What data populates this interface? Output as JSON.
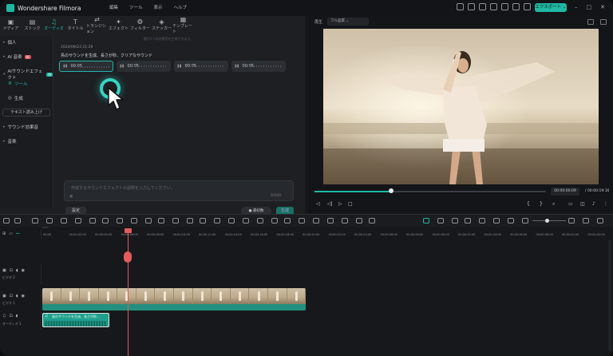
{
  "app": {
    "title": "Wondershare Filmora",
    "export_label": "エクスポート ⌄"
  },
  "menu": [
    "編集",
    "ツール",
    "表示",
    "ヘルプ"
  ],
  "tabs": [
    {
      "label": "メディア",
      "icon": "media-icon"
    },
    {
      "label": "ストック",
      "icon": "stock-icon"
    },
    {
      "label": "オーディオ",
      "icon": "music-note-icon"
    },
    {
      "label": "タイトル",
      "icon": "title-icon"
    },
    {
      "label": "トランジション",
      "icon": "transition-icon"
    },
    {
      "label": "エフェクト",
      "icon": "effect-icon"
    },
    {
      "label": "フィルター",
      "icon": "filter-icon"
    },
    {
      "label": "ステッカー",
      "icon": "sticker-icon"
    },
    {
      "label": "テンプレート",
      "icon": "template-icon"
    }
  ],
  "sidebar": {
    "items": [
      {
        "label": "個人"
      },
      {
        "label": "AI 音楽",
        "badge": "AI"
      },
      {
        "label": "AIサウンドエフェクト",
        "badge": "AI"
      },
      {
        "label": "ツール"
      },
      {
        "label": "生成"
      },
      {
        "label": "サウンド効果音"
      },
      {
        "label": "音楽"
      }
    ],
    "tts_button": "テキスト読み上げ"
  },
  "content": {
    "hint": "最大5つの効果音を生成できます。",
    "timestamp": "2024/09/23 21:29",
    "prompt": "鳥のサウンドを生成、長さが秒、クリアなサウンド",
    "results": [
      "00:05",
      "00:05",
      "00:05",
      "00:05"
    ],
    "input_placeholder": "作成するサウンドエフェクトの説明を入力してください。",
    "char_count": "0/100",
    "settings_label": "設定",
    "credit_label": "最初数",
    "generate_label": "生成"
  },
  "preview": {
    "label": "再生",
    "quality": "フル品質",
    "current_time": "00:00:00:09",
    "separator": "/",
    "total_time": "00:00:19:16",
    "progress": 0.33
  },
  "ruler": {
    "labels": [
      "00:00",
      "00:00:02:00",
      "00:00:04:00",
      "00:00:06:00",
      "00:00:08:00",
      "00:00:10:00",
      "00:00:12:00",
      "00:00:14:00",
      "00:00:16:00",
      "00:00:18:00",
      "00:00:20:00",
      "00:00:22:00",
      "00:00:24:00",
      "00:00:26:00",
      "00:00:28:00",
      "00:00:30:00",
      "00:00:32:00",
      "00:00:34:00",
      "00:00:36:00",
      "00:00:38:00",
      "00:00:40:00",
      "00:00:42:00"
    ]
  },
  "tracks": {
    "video2": "ビデオ 2",
    "video1": "ビデオ 1",
    "audio1": "オーディオ 1",
    "audio_clip_label": "鳥のサウンドを生成、長さが秒…"
  },
  "colors": {
    "accent": "#1fb8a4",
    "playhead": "#e35b5b",
    "video_clip": "#23907f"
  }
}
